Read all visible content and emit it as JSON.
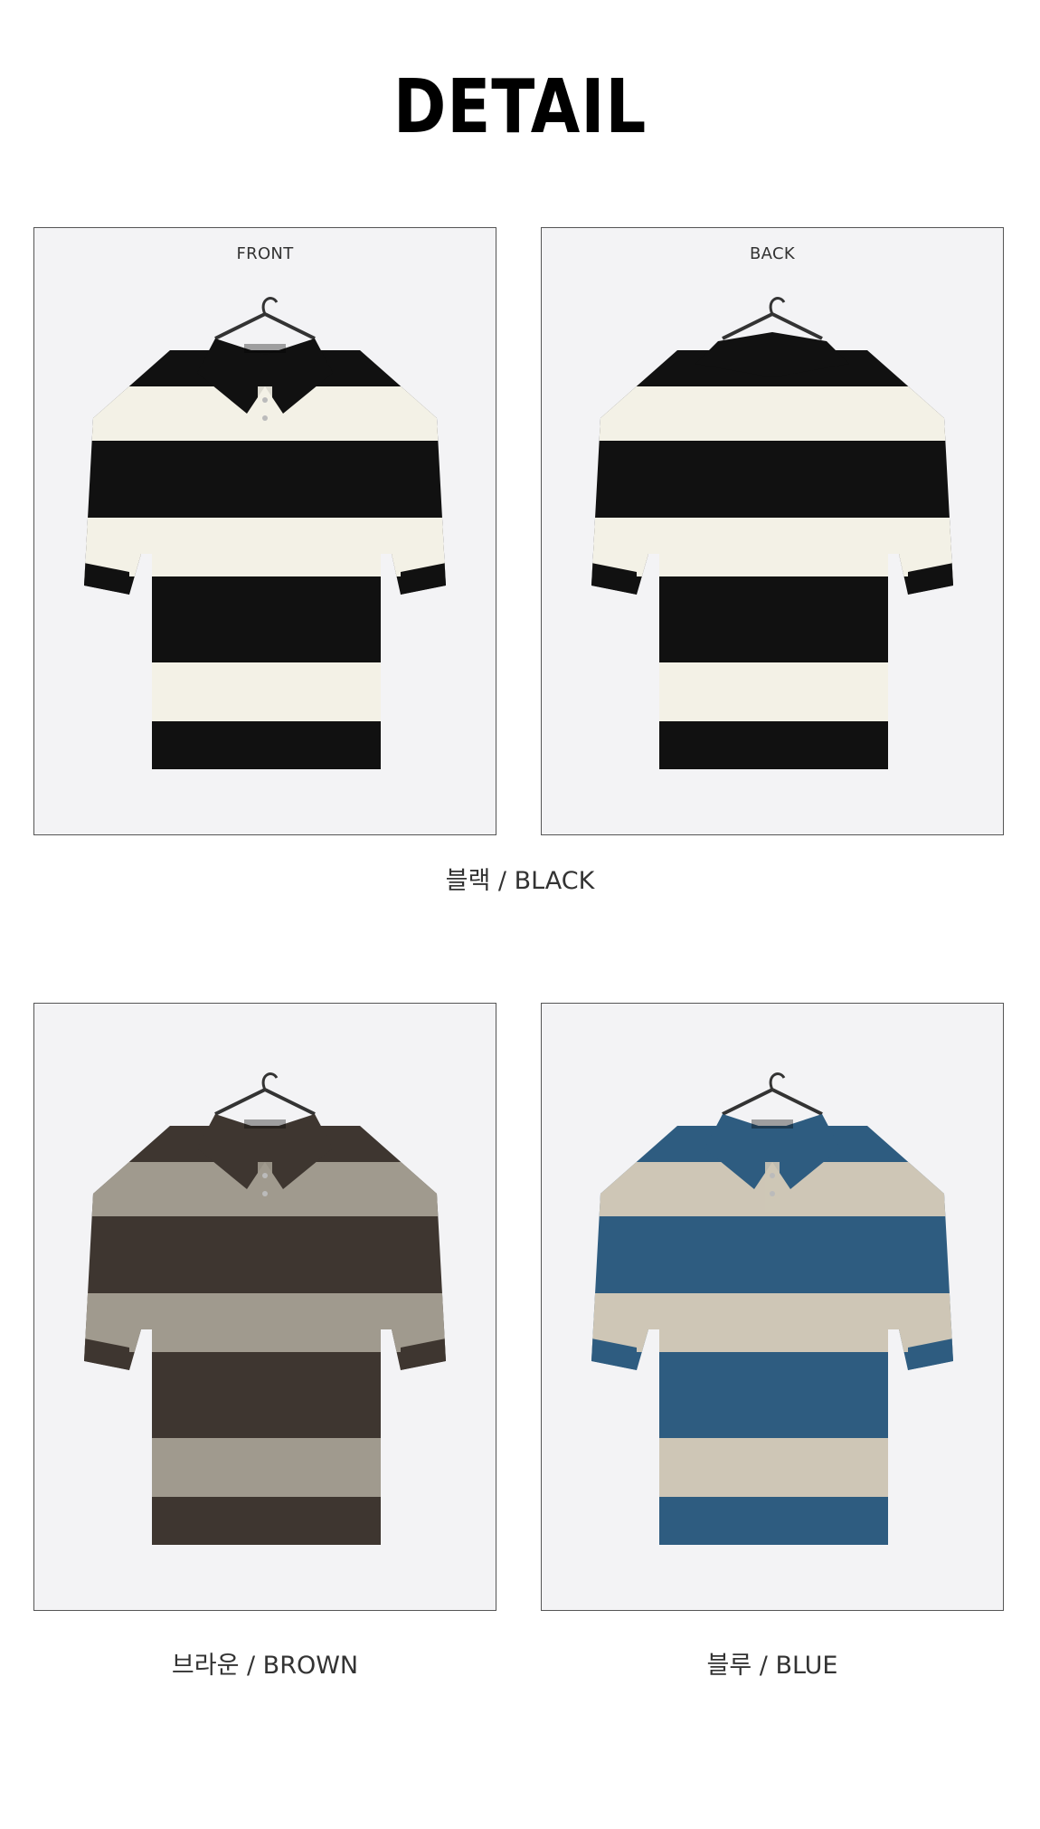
{
  "header": {
    "title": "DETAIL"
  },
  "panels": {
    "black_front": {
      "label": "FRONT",
      "colors": {
        "dark": "#111111",
        "light": "#f3f1e6"
      },
      "view": "front"
    },
    "black_back": {
      "label": "BACK",
      "colors": {
        "dark": "#111111",
        "light": "#f3f1e6"
      },
      "view": "back"
    },
    "brown_front": {
      "label": "",
      "colors": {
        "dark": "#3e3630",
        "light": "#a09a8e"
      },
      "view": "front"
    },
    "blue_front": {
      "label": "",
      "colors": {
        "dark": "#2e5c80",
        "light": "#cec6b6"
      },
      "view": "front"
    }
  },
  "captions": {
    "black": "블랙 / BLACK",
    "brown": "브라운 / BROWN",
    "blue": "블루 / BLUE"
  },
  "icons": {
    "hanger": "hanger-icon",
    "garment": "polo-knit-shirt"
  }
}
